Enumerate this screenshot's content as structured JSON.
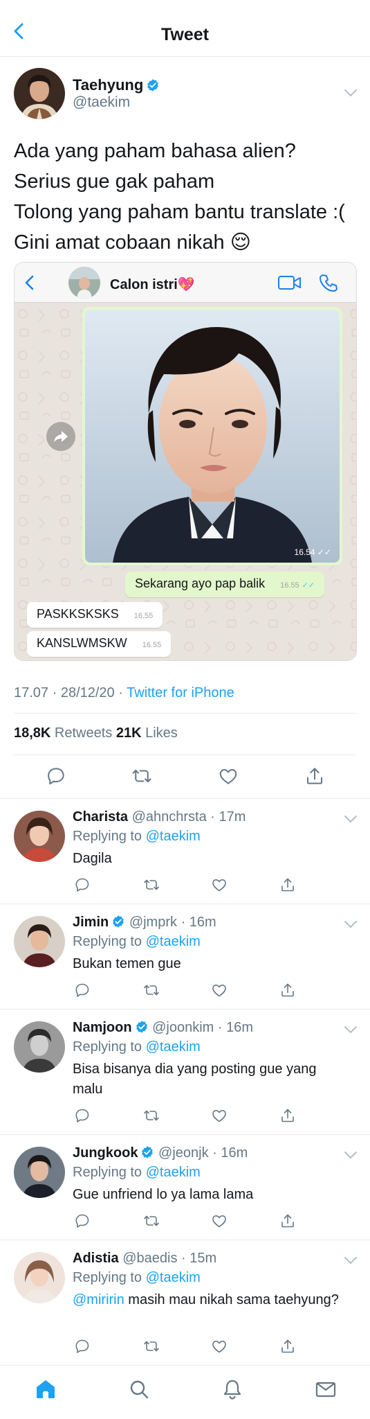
{
  "header": {
    "title": "Tweet"
  },
  "tweet": {
    "author_name": "Taehyung",
    "author_handle": "@taekim",
    "text_lines": [
      "Ada yang paham bahasa alien?",
      "Serius gue gak paham",
      "Tolong yang paham bantu translate :(",
      "Gini amat cobaan nikah 😌"
    ],
    "media": {
      "chat_name": "Calon istri💖",
      "photo_time": "16.54",
      "messages": [
        {
          "text": "Sekarang ayo pap balik",
          "time": "16.55",
          "dir": "out"
        },
        {
          "text": "PASKKSKSKS",
          "time": "16.55",
          "dir": "in"
        },
        {
          "text": "KANSLWMSKW",
          "time": "16.55",
          "dir": "in"
        }
      ]
    },
    "time": "17.07 · 28/12/20 · ",
    "source": "Twitter for iPhone",
    "retweets_count": "18,8K",
    "retweets_label": " Retweets  ",
    "likes_count": "21K",
    "likes_label": " Likes"
  },
  "replies": [
    {
      "name": "Charista",
      "verified": false,
      "handle": "@ahnchrsta",
      "time": "17m",
      "replying_label": "Replying to ",
      "replying_to": "@taekim",
      "mention": "",
      "text": "Dagila"
    },
    {
      "name": "Jimin",
      "verified": true,
      "handle": "@jmprk",
      "time": "16m",
      "replying_label": "Replying to ",
      "replying_to": "@taekim",
      "mention": "",
      "text": "Bukan temen gue"
    },
    {
      "name": "Namjoon",
      "verified": true,
      "handle": "@joonkim",
      "time": "16m",
      "replying_label": "Replying to ",
      "replying_to": "@taekim",
      "mention": "",
      "text": "Bisa bisanya dia yang posting gue yang malu"
    },
    {
      "name": "Jungkook",
      "verified": true,
      "handle": "@jeonjk",
      "time": "16m",
      "replying_label": "Replying to ",
      "replying_to": "@taekim",
      "mention": "",
      "text": "Gue unfriend lo ya lama lama"
    },
    {
      "name": "Adistia",
      "verified": false,
      "handle": "@baedis",
      "time": "15m",
      "replying_label": "Replying to ",
      "replying_to": "@taekim",
      "mention": "@miririn",
      "text": " masih mau nikah sama taehyung?"
    }
  ],
  "colors": {
    "accent": "#1da1f2",
    "secondary_text": "#657786",
    "chat_out": "#e2f7cb"
  },
  "icons": [
    "back-arrow-icon",
    "verified-badge-icon",
    "chevron-down-icon",
    "reply-icon",
    "retweet-icon",
    "like-icon",
    "share-icon",
    "home-icon",
    "search-icon",
    "notifications-icon",
    "messages-icon"
  ]
}
